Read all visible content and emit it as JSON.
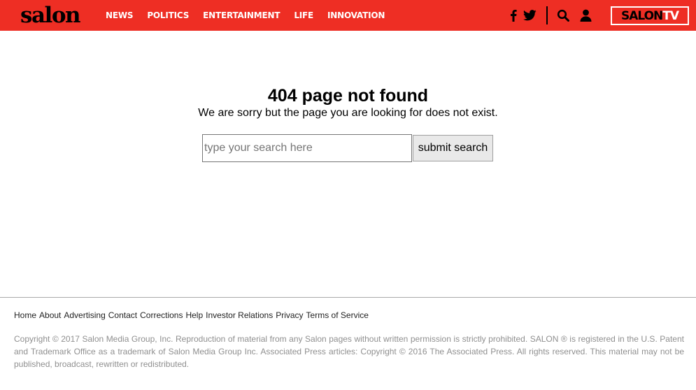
{
  "header": {
    "logo": "salon",
    "nav": [
      "NEWS",
      "POLITICS",
      "ENTERTAINMENT",
      "LIFE",
      "INNOVATION"
    ],
    "icons": [
      "facebook-icon",
      "twitter-icon",
      "search-icon",
      "user-icon"
    ],
    "salontv": {
      "part1": "SALON",
      "part2": "TV"
    },
    "bg_color": "#ee2e24"
  },
  "main": {
    "title": "404 page not found",
    "subtitle": "We are sorry but the page you are looking for does not exist.",
    "search": {
      "placeholder": "type your search here",
      "value": ""
    },
    "submit_label": "submit search"
  },
  "footer": {
    "links": [
      "Home",
      "About",
      "Advertising",
      "Contact",
      "Corrections",
      "Help",
      "Investor Relations",
      "Privacy",
      "Terms of Service"
    ],
    "copyright": "Copyright © 2017 Salon Media Group, Inc. Reproduction of material from any Salon pages without written permission is strictly prohibited. SALON ® is registered in the U.S. Patent and Trademark Office as a trademark of Salon Media Group Inc. Associated Press articles: Copyright © 2016 The Associated Press. All rights reserved. This material may not be published, broadcast, rewritten or redistributed."
  }
}
